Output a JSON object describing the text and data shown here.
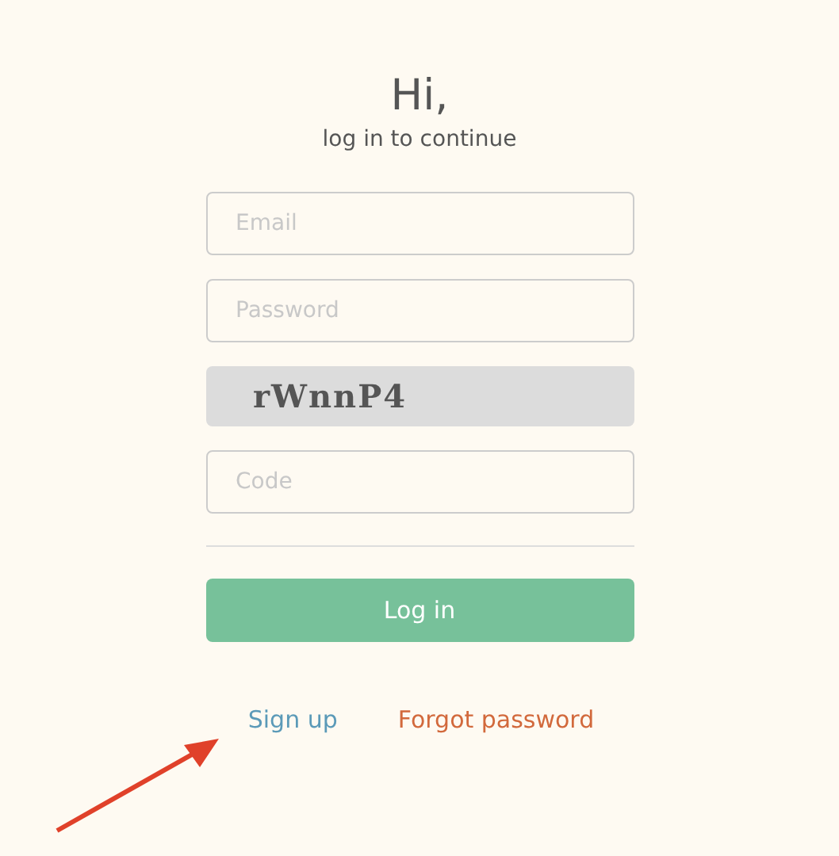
{
  "heading": "Hi,",
  "subheading": "log in to continue",
  "fields": [
    {
      "kind": "input",
      "placeholder": "Email"
    },
    {
      "kind": "input",
      "placeholder": "Password"
    },
    {
      "kind": "captcha",
      "text": "rWnnP4"
    },
    {
      "kind": "input",
      "placeholder": "Code"
    }
  ],
  "login_button": "Log in",
  "links": [
    {
      "label": "Sign up",
      "color": "#5b9ab8"
    },
    {
      "label": "Forgot password",
      "color": "#d2693c"
    }
  ],
  "annotation": {
    "kind": "arrow"
  }
}
